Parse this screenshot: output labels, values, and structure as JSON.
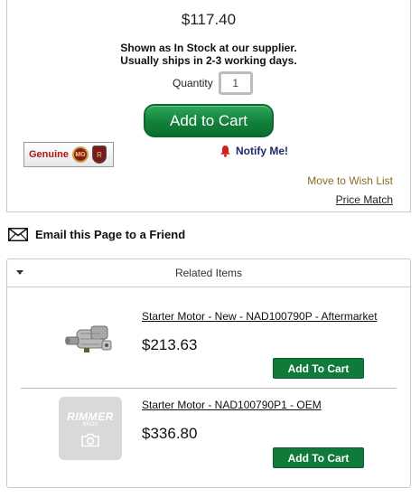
{
  "product": {
    "price": "$117.40",
    "stock_line1": "Shown as In Stock at our supplier.",
    "stock_line2": "Usually ships in 2-3 working days.",
    "quantity_label": "Quantity",
    "quantity_value": "1",
    "add_to_cart_label": "Add to Cart",
    "genuine_label": "Genuine",
    "mg_logo_text": "MG",
    "rover_logo_text": "R",
    "notify_label": "Notify Me!",
    "wishlist_label": "Move to Wish List",
    "price_match_label": "Price Match"
  },
  "email": {
    "label": "Email this Page to a Friend",
    "icon": "mail-icon"
  },
  "related": {
    "header": "Related Items",
    "items": [
      {
        "title": "Starter Motor - New - NAD100790P - Aftermarket",
        "price": "$213.63",
        "cart_label": "Add To Cart",
        "image": "starter-motor-photo"
      },
      {
        "title": "Starter Motor - NAD100790P1 - OEM",
        "price": "$336.80",
        "cart_label": "Add To Cart",
        "image": "rimmer-placeholder",
        "placeholder_brand": "RIMMER",
        "placeholder_sub": "BROS"
      }
    ]
  },
  "colors": {
    "cart_green": "#0f7a3a",
    "notify_navy": "#1c2b66",
    "wishlist_gold": "#8a6a2a",
    "genuine_red": "#b01717"
  }
}
